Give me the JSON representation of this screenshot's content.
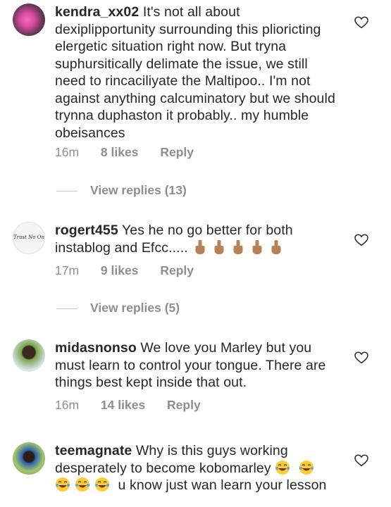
{
  "comments": [
    {
      "username": "kendra_xx02",
      "text": "It's not all about dexiplipportunity surrounding this plioricting elergetic situation right now. But tryna suphursitically delimate the issue, we still need to rincaciliyate the Maltipoo.. I'm not against anything calcuminatory but we should trynna duphaston it probably.. my humble obeisances",
      "time": "16m",
      "likes": "8 likes",
      "reply": "Reply",
      "view_replies": "View replies (13)"
    },
    {
      "username": "rogert455",
      "text": "Yes he no go better for both instablog and Efcc.....",
      "avatar_text": "Trust No One",
      "time": "17m",
      "likes": "9 likes",
      "reply": "Reply",
      "view_replies": "View replies (5)"
    },
    {
      "username": "midasnonso",
      "text": "We love you Marley but you must learn to control your tongue. There are things best kept inside that out.",
      "time": "16m",
      "likes": "14 likes",
      "reply": "Reply"
    },
    {
      "username": "teemagnate",
      "text_before": "Why is this guys working desperately to become kobomarley",
      "text_after": "u know just wan learn your lesson"
    }
  ],
  "icons": {
    "heart": "heart-outline-icon",
    "fist": "raised-fist-emoji",
    "laugh": "tears-of-joy-emoji"
  },
  "colors": {
    "text": "#262626",
    "meta": "#8e8e8e",
    "emoji_skin": "#b98256",
    "emoji_yellow": "#ffcc33"
  }
}
